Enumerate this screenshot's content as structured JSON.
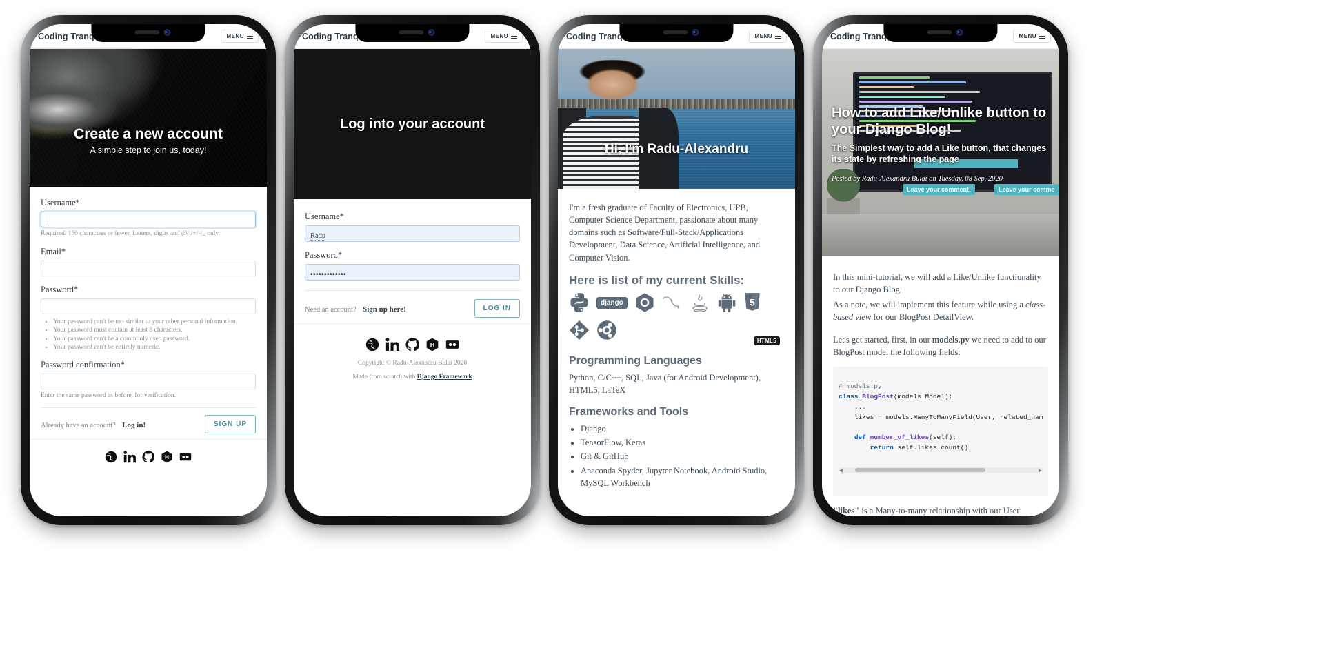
{
  "site": {
    "brand": "Coding Tranquillity",
    "menu_label": "MENU"
  },
  "phones": [
    {
      "id": "signup",
      "hero": {
        "title": "Create a new account",
        "subtitle": "A simple step to join us, today!",
        "image": "cat-photo"
      },
      "form": {
        "username_label": "Username*",
        "username_value": "",
        "username_help": "Required. 150 characters or fewer. Letters, digits and @/./+/-/_ only.",
        "email_label": "Email*",
        "email_value": "",
        "password_label": "Password*",
        "password_value": "",
        "password_rules": [
          "Your password can't be too similar to your other personal information.",
          "Your password must contain at least 8 characters.",
          "Your password can't be a commonly used password.",
          "Your password can't be entirely numeric."
        ],
        "confirm_label": "Password confirmation*",
        "confirm_value": "",
        "confirm_help": "Enter the same password as before, for verification.",
        "already_text": "Already have an account?",
        "login_link": "Log in!",
        "submit_label": "SIGN UP"
      }
    },
    {
      "id": "login",
      "hero": {
        "title": "Log into your account",
        "image": "plain-dark"
      },
      "form": {
        "username_label": "Username*",
        "username_value": "Radu",
        "password_label": "Password*",
        "password_value": "•••••••••••••",
        "need_text": "Need an account?",
        "signup_link": "Sign up here!",
        "submit_label": "LOG IN"
      },
      "footer": {
        "copyright": "Copyright © Radu-Alexandru Bulai 2020",
        "made_prefix": "Made from scratch with",
        "made_link": "Django Framework"
      }
    },
    {
      "id": "about",
      "hero": {
        "title": "Hi, I'm Radu-Alexandru",
        "image": "portrait-photo"
      },
      "intro": "I'm a fresh graduate of Faculty of Electronics, UPB, Computer Science Department, passionate about many domains such as Software/Full-Stack/Applications Development, Data Science, Artificial Intelligence, and Computer Vision.",
      "skills_heading": "Here is list of my current Skills:",
      "skill_icons": [
        "python-icon",
        "django-icon",
        "cplusplus-icon",
        "mysql-icon",
        "java-icon",
        "android-icon",
        "html5-icon",
        "git-icon",
        "ubuntu-icon"
      ],
      "html5_badge": "HTML5",
      "languages_heading": "Programming Languages",
      "languages_text": "Python, C/C++, SQL, Java (for Android Development), HTML5, LaTeX",
      "frameworks_heading": "Frameworks and Tools",
      "frameworks": [
        "Django",
        "TensorFlow, Keras",
        "Git & GitHub",
        "Anaconda Spyder, Jupyter Notebook, Android Studio, MySQL Workbench"
      ]
    },
    {
      "id": "post",
      "hero": {
        "title": "How to add Like/Unlike button to your Django Blog!",
        "subtitle": "The Simplest way to add a Like button, that changes its state by refreshing the page",
        "meta": "Posted by Radu-Alexandru Bulai on Tuesday, 08 Sep, 2020",
        "image": "monitor-photo",
        "tooltip_left": "Leave your comment!",
        "tooltip_right": "Leave your comme"
      },
      "paragraphs": [
        "In this mini-tutorial, we will add a Like/Unlike functionality to our Django Blog.",
        "As a note, we will implement this feature while using a class-based view for our BlogPost DetailView.",
        "Let's get started, first, in our models.py we need to add to our BlogPost model the following fields:"
      ],
      "code": {
        "comment": "# models.py",
        "lines": [
          "class BlogPost(models.Model):",
          "    ...",
          "    likes = models.ManyToManyField(User, related_nam",
          "",
          "    def number_of_likes(self):",
          "        return self.likes.count()"
        ]
      },
      "closing": "\"likes\" is a Many-to-many relationship with our User"
    }
  ],
  "socials": [
    "globe-icon",
    "linkedin-icon",
    "github-icon",
    "hackerrank-icon",
    "flickr-icon"
  ],
  "colors": {
    "brand_text": "#2b3a47",
    "heading": "#5d6b78",
    "accent_teal": "#4fb3bf",
    "button_outline": "#3b8c9c",
    "muted": "#8a9199"
  }
}
